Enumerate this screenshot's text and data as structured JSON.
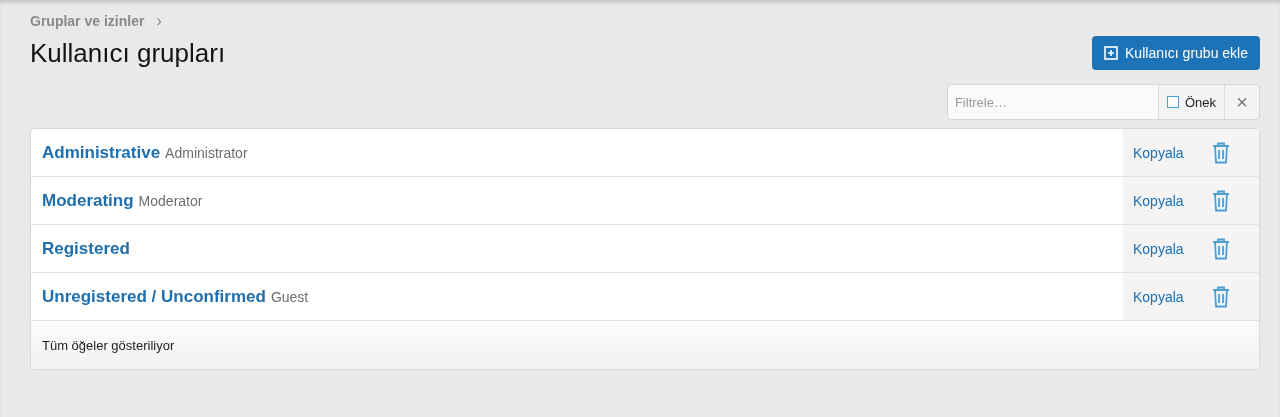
{
  "breadcrumb": [
    {
      "label": "Gruplar ve izinler",
      "separator": "›"
    }
  ],
  "title": "Kullanıcı grupları",
  "add_button": {
    "label": "Kullanıcı grubu ekle"
  },
  "filter": {
    "placeholder": "Filtrele…",
    "prefix_label": "Önek",
    "prefix_checked": false,
    "clear": "×"
  },
  "groups": [
    {
      "name": "Administrative",
      "title": "Administrator",
      "action": "Kopyala"
    },
    {
      "name": "Moderating",
      "title": "Moderator",
      "action": "Kopyala"
    },
    {
      "name": "Registered",
      "action": "Kopyala"
    },
    {
      "name": "Unregistered / Unconfirmed",
      "title": "Guest",
      "action": "Kopyala"
    }
  ],
  "footer": "Tüm öğeler gösteriliyor"
}
